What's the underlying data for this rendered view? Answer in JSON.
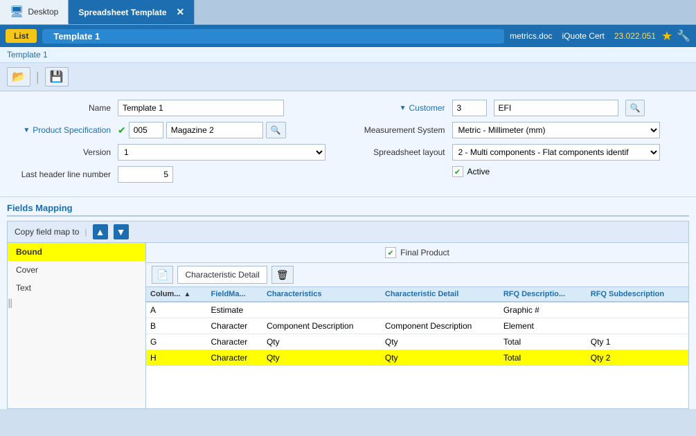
{
  "tabs": [
    {
      "id": "desktop",
      "label": "Desktop",
      "active": false
    },
    {
      "id": "spreadsheet",
      "label": "Spreadsheet Template",
      "active": true
    }
  ],
  "nav": {
    "list_label": "List",
    "title": "Template 1",
    "metrics": "metrics.doc",
    "iquote": "iQuote Cert",
    "version": "23.022.051"
  },
  "breadcrumb": "Template 1",
  "toolbar": {
    "open_icon": "📂",
    "save_icon": "💾"
  },
  "form": {
    "name_label": "Name",
    "name_value": "Template 1",
    "customer_label": "Customer",
    "customer_id": "3",
    "customer_name": "EFI",
    "product_spec_label": "Product Specification",
    "product_code": "005",
    "product_name": "Magazine 2",
    "version_label": "Version",
    "version_value": "1",
    "last_header_label": "Last header line number",
    "last_header_value": "5",
    "measurement_label": "Measurement System",
    "measurement_value": "Metric - Millimeter (mm)",
    "spreadsheet_label": "Spreadsheet layout",
    "spreadsheet_value": "2 - Multi components - Flat components identif",
    "active_label": "Active",
    "active_checked": true
  },
  "fields_mapping": {
    "title": "Fields Mapping",
    "copy_label": "Copy field map to",
    "up_label": "▲",
    "down_label": "▼",
    "list_items": [
      {
        "label": "Bound",
        "active": true
      },
      {
        "label": "Cover",
        "active": false
      },
      {
        "label": "Text",
        "active": false
      }
    ],
    "final_product_label": "Final Product",
    "char_detail_label": "Characteristic Detail",
    "table": {
      "columns": [
        "Colum...",
        "FieldMa...",
        "Characteristics",
        "Characteristic Detail",
        "RFQ Descriptio...",
        "RFQ Subdescription"
      ],
      "rows": [
        {
          "col": "A",
          "fieldma": "Estimate",
          "chars": "",
          "char_detail": "",
          "rfq_desc": "Graphic #",
          "rfq_sub": "",
          "highlighted": false
        },
        {
          "col": "B",
          "fieldma": "Character",
          "chars": "Component Description",
          "char_detail": "Component Description",
          "rfq_desc": "Element",
          "rfq_sub": "",
          "highlighted": false
        },
        {
          "col": "G",
          "fieldma": "Character",
          "chars": "Qty",
          "char_detail": "Qty",
          "rfq_desc": "Total",
          "rfq_sub": "Qty 1",
          "highlighted": false
        },
        {
          "col": "H",
          "fieldma": "Character",
          "chars": "Qty",
          "char_detail": "Qty",
          "rfq_desc": "Total",
          "rfq_sub": "Qty 2",
          "highlighted": true
        }
      ]
    }
  }
}
